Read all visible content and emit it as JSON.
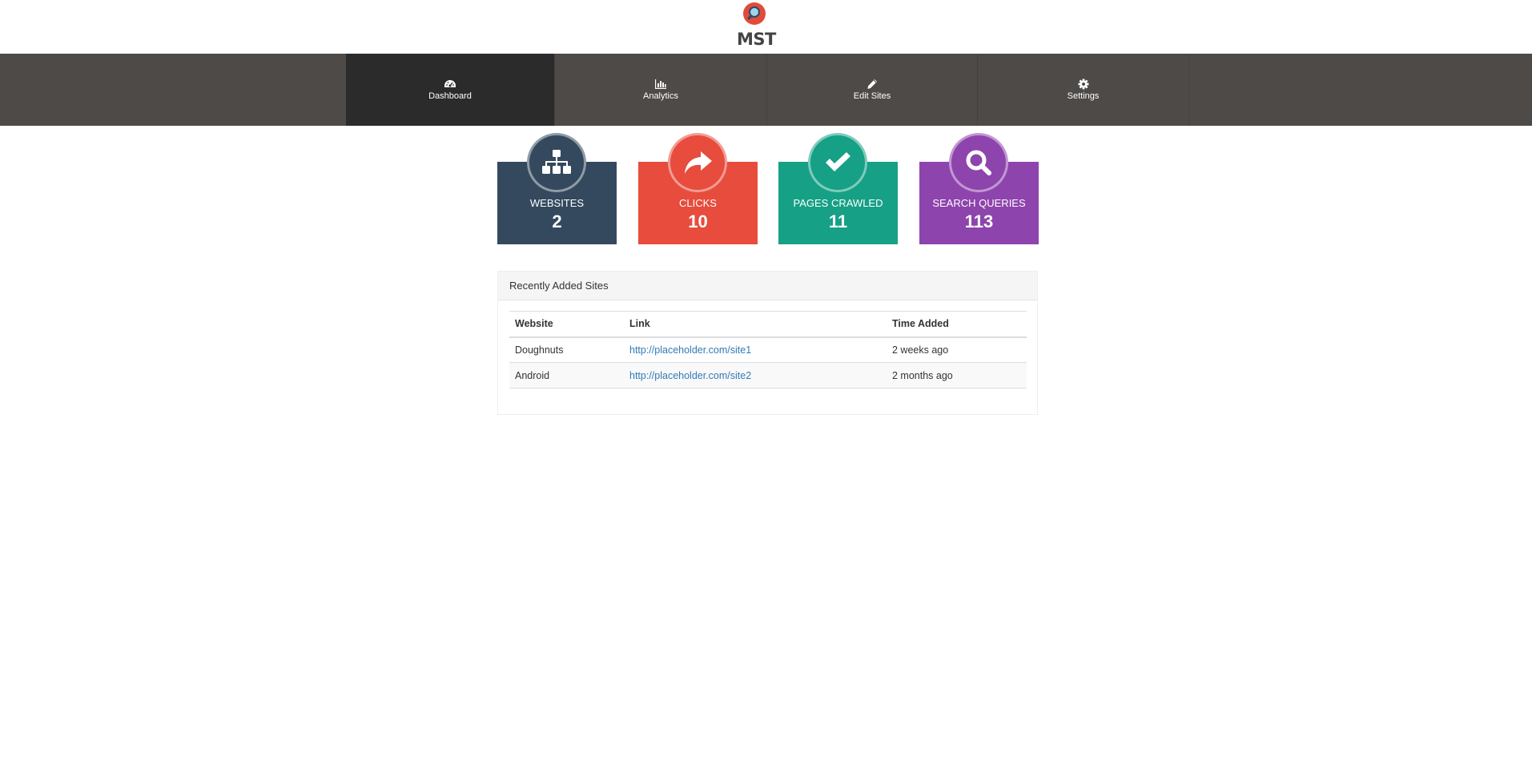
{
  "brand": {
    "logo_text": "MST"
  },
  "nav": {
    "items": [
      {
        "label": "Dashboard",
        "icon": "dashboard-icon",
        "active": true
      },
      {
        "label": "Analytics",
        "icon": "bar-chart-icon",
        "active": false
      },
      {
        "label": "Edit Sites",
        "icon": "pencil-icon",
        "active": false
      },
      {
        "label": "Settings",
        "icon": "gear-icon",
        "active": false
      }
    ]
  },
  "stats": [
    {
      "label": "WEBSITES",
      "value": "2",
      "icon": "sitemap-icon",
      "color": "#34495e"
    },
    {
      "label": "CLICKS",
      "value": "10",
      "icon": "share-icon",
      "color": "#e74c3c"
    },
    {
      "label": "PAGES CRAWLED",
      "value": "11",
      "icon": "check-icon",
      "color": "#16a085"
    },
    {
      "label": "SEARCH QUERIES",
      "value": "113",
      "icon": "search-icon",
      "color": "#8e44ad"
    }
  ],
  "recent_sites": {
    "title": "Recently Added Sites",
    "columns": [
      "Website",
      "Link",
      "Time Added"
    ],
    "rows": [
      {
        "website": "Doughnuts",
        "link": "http://placeholder.com/site1",
        "time": "2 weeks ago"
      },
      {
        "website": "Android",
        "link": "http://placeholder.com/site2",
        "time": "2 months ago"
      }
    ]
  }
}
